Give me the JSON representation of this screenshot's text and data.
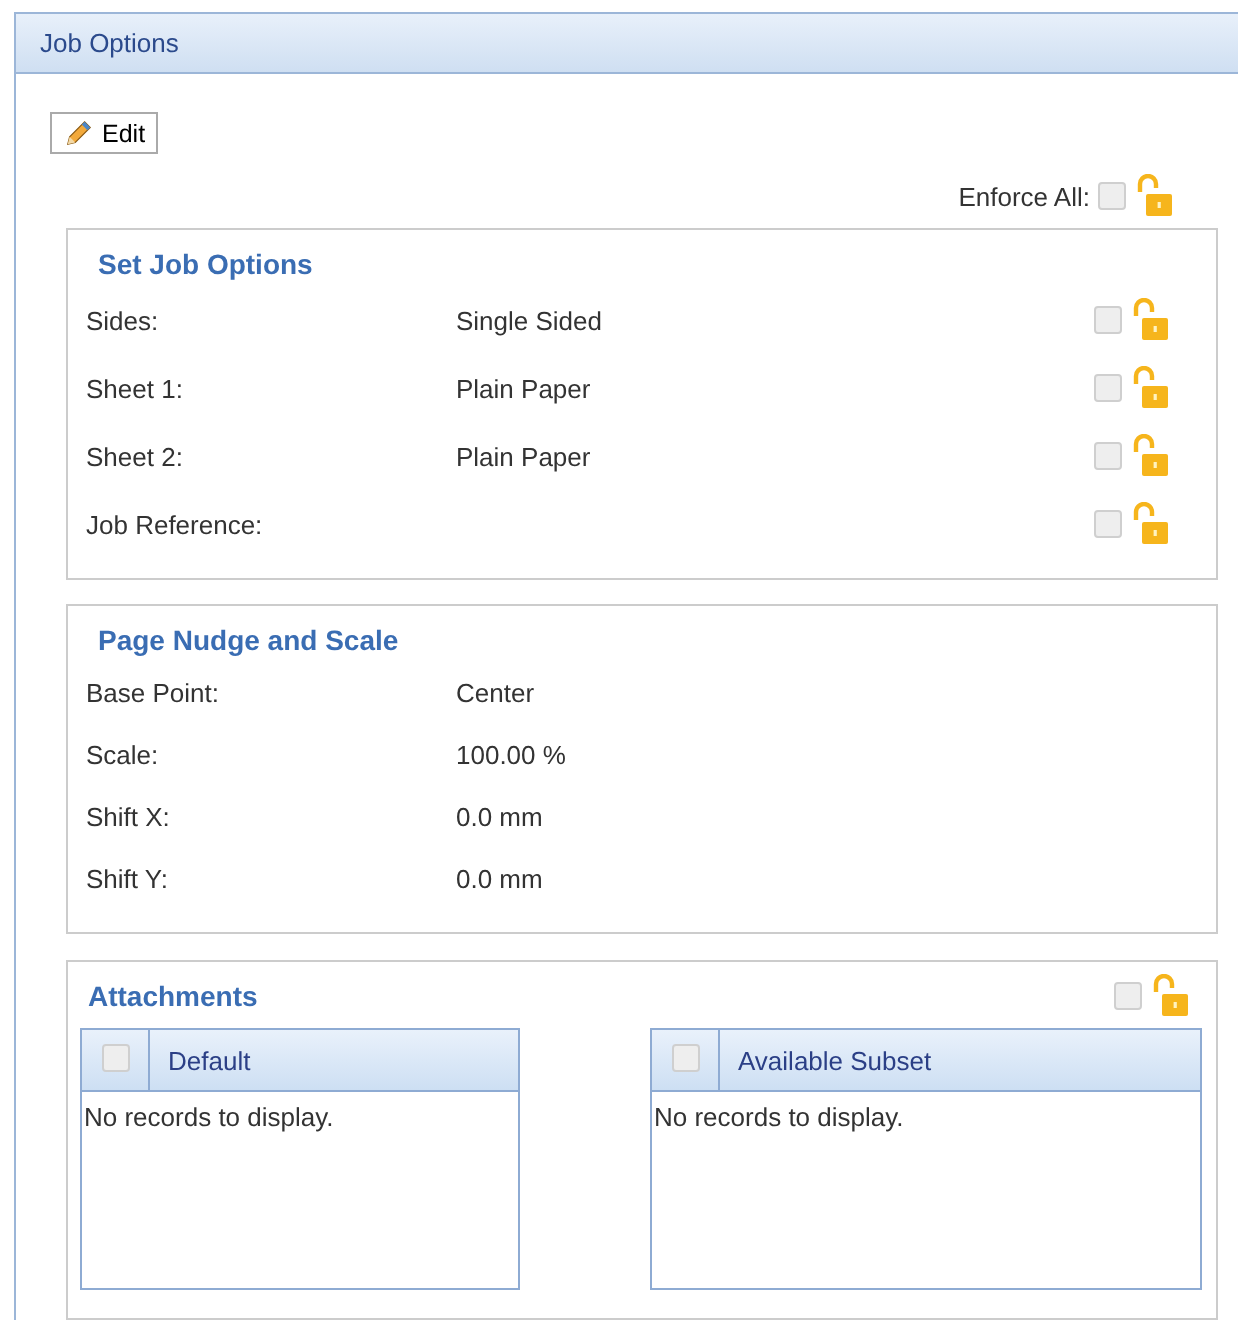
{
  "window": {
    "title": "Job Options"
  },
  "edit_button": {
    "label": "Edit"
  },
  "enforce_all": {
    "label": "Enforce All:",
    "checked": false,
    "locked": false
  },
  "set_job_options": {
    "title": "Set Job Options",
    "rows": [
      {
        "label": "Sides:",
        "value": "Single Sided",
        "checked": false,
        "locked": false
      },
      {
        "label": "Sheet 1:",
        "value": "Plain Paper",
        "checked": false,
        "locked": false
      },
      {
        "label": "Sheet 2:",
        "value": "Plain Paper",
        "checked": false,
        "locked": false
      },
      {
        "label": "Job Reference:",
        "checked": false,
        "locked": false
      }
    ]
  },
  "page_nudge_and_scale": {
    "title": "Page Nudge and Scale",
    "rows": [
      {
        "label": "Base Point:",
        "value": "Center"
      },
      {
        "label": "Scale:",
        "value": "100.00 %"
      },
      {
        "label": "Shift X:",
        "value": "0.0 mm"
      },
      {
        "label": "Shift Y:",
        "value": "0.0 mm"
      }
    ]
  },
  "attachments": {
    "title": "Attachments",
    "checked": false,
    "locked": false,
    "grids": [
      {
        "header": "Default",
        "header_checked": false,
        "empty_text": "No records to display."
      },
      {
        "header": "Available Subset",
        "header_checked": false,
        "empty_text": "No records to display."
      }
    ]
  }
}
